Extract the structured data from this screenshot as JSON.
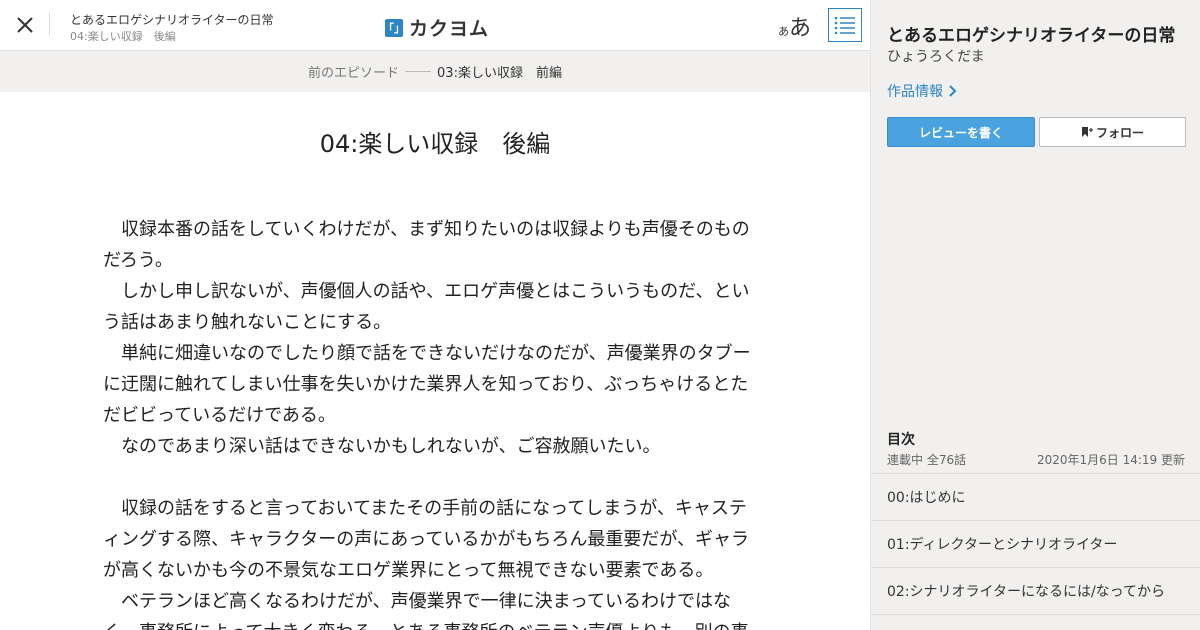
{
  "header": {
    "work_title": "とあるエロゲシナリオライターの日常",
    "episode_subtitle": "04:楽しい収録　後編",
    "logo_mark": "「」",
    "logo_text": "カクヨム",
    "font_small": "あ",
    "font_large": "あ"
  },
  "prev_nav": {
    "label": "前のエピソード",
    "title": "03:楽しい収録　前編"
  },
  "episode": {
    "title": "04:楽しい収録　後編",
    "paragraphs": [
      "　収録本番の話をしていくわけだが、まず知りたいのは収録よりも声優そのものだろう。",
      "　しかし申し訳ないが、声優個人の話や、エロゲ声優とはこういうものだ、という話はあまり触れないことにする。",
      "　単純に畑違いなのでしたり顔で話をできないだけなのだが、声優業界のタブーに迂闊に触れてしまい仕事を失いかけた業界人を知っており、ぶっちゃけるとただビビっているだけである。",
      "　なのであまり深い話はできないかもしれないが、ご容赦願いたい。",
      "",
      "　収録の話をすると言っておいてまたその手前の話になってしまうが、キャスティングする際、キャラクターの声にあっているかがもちろん最重要だが、ギャラが高くないかも今の不景気なエロゲ業界にとって無視できない要素である。",
      "　ベテランほど高くなるわけだが、声優業界で一律に決まっているわけではなく、事務所によって大きく変わる。とある事務所のベテラン声優よりも、別の事"
    ]
  },
  "sidebar": {
    "title": "とあるエロゲシナリオライターの日常",
    "author": "ひょうろくだま",
    "work_info": "作品情報",
    "review_button": "レビューを書く",
    "follow_button": "フォロー",
    "toc_heading": "目次",
    "status": "連載中 全76話",
    "updated": "2020年1月6日 14:19 更新",
    "toc_items": [
      "00:はじめに",
      "01:ディレクターとシナリオライター",
      "02:シナリオライターになるには/なってから"
    ]
  },
  "colors": {
    "accent": "#2c85c5",
    "review_button": "#4aa3df",
    "sidebar_bg": "#f1f0ee"
  },
  "icons": {
    "close": "close-icon",
    "toc": "list-icon",
    "chevron": "chevron-right-icon",
    "bookmark": "bookmark-plus-icon"
  }
}
